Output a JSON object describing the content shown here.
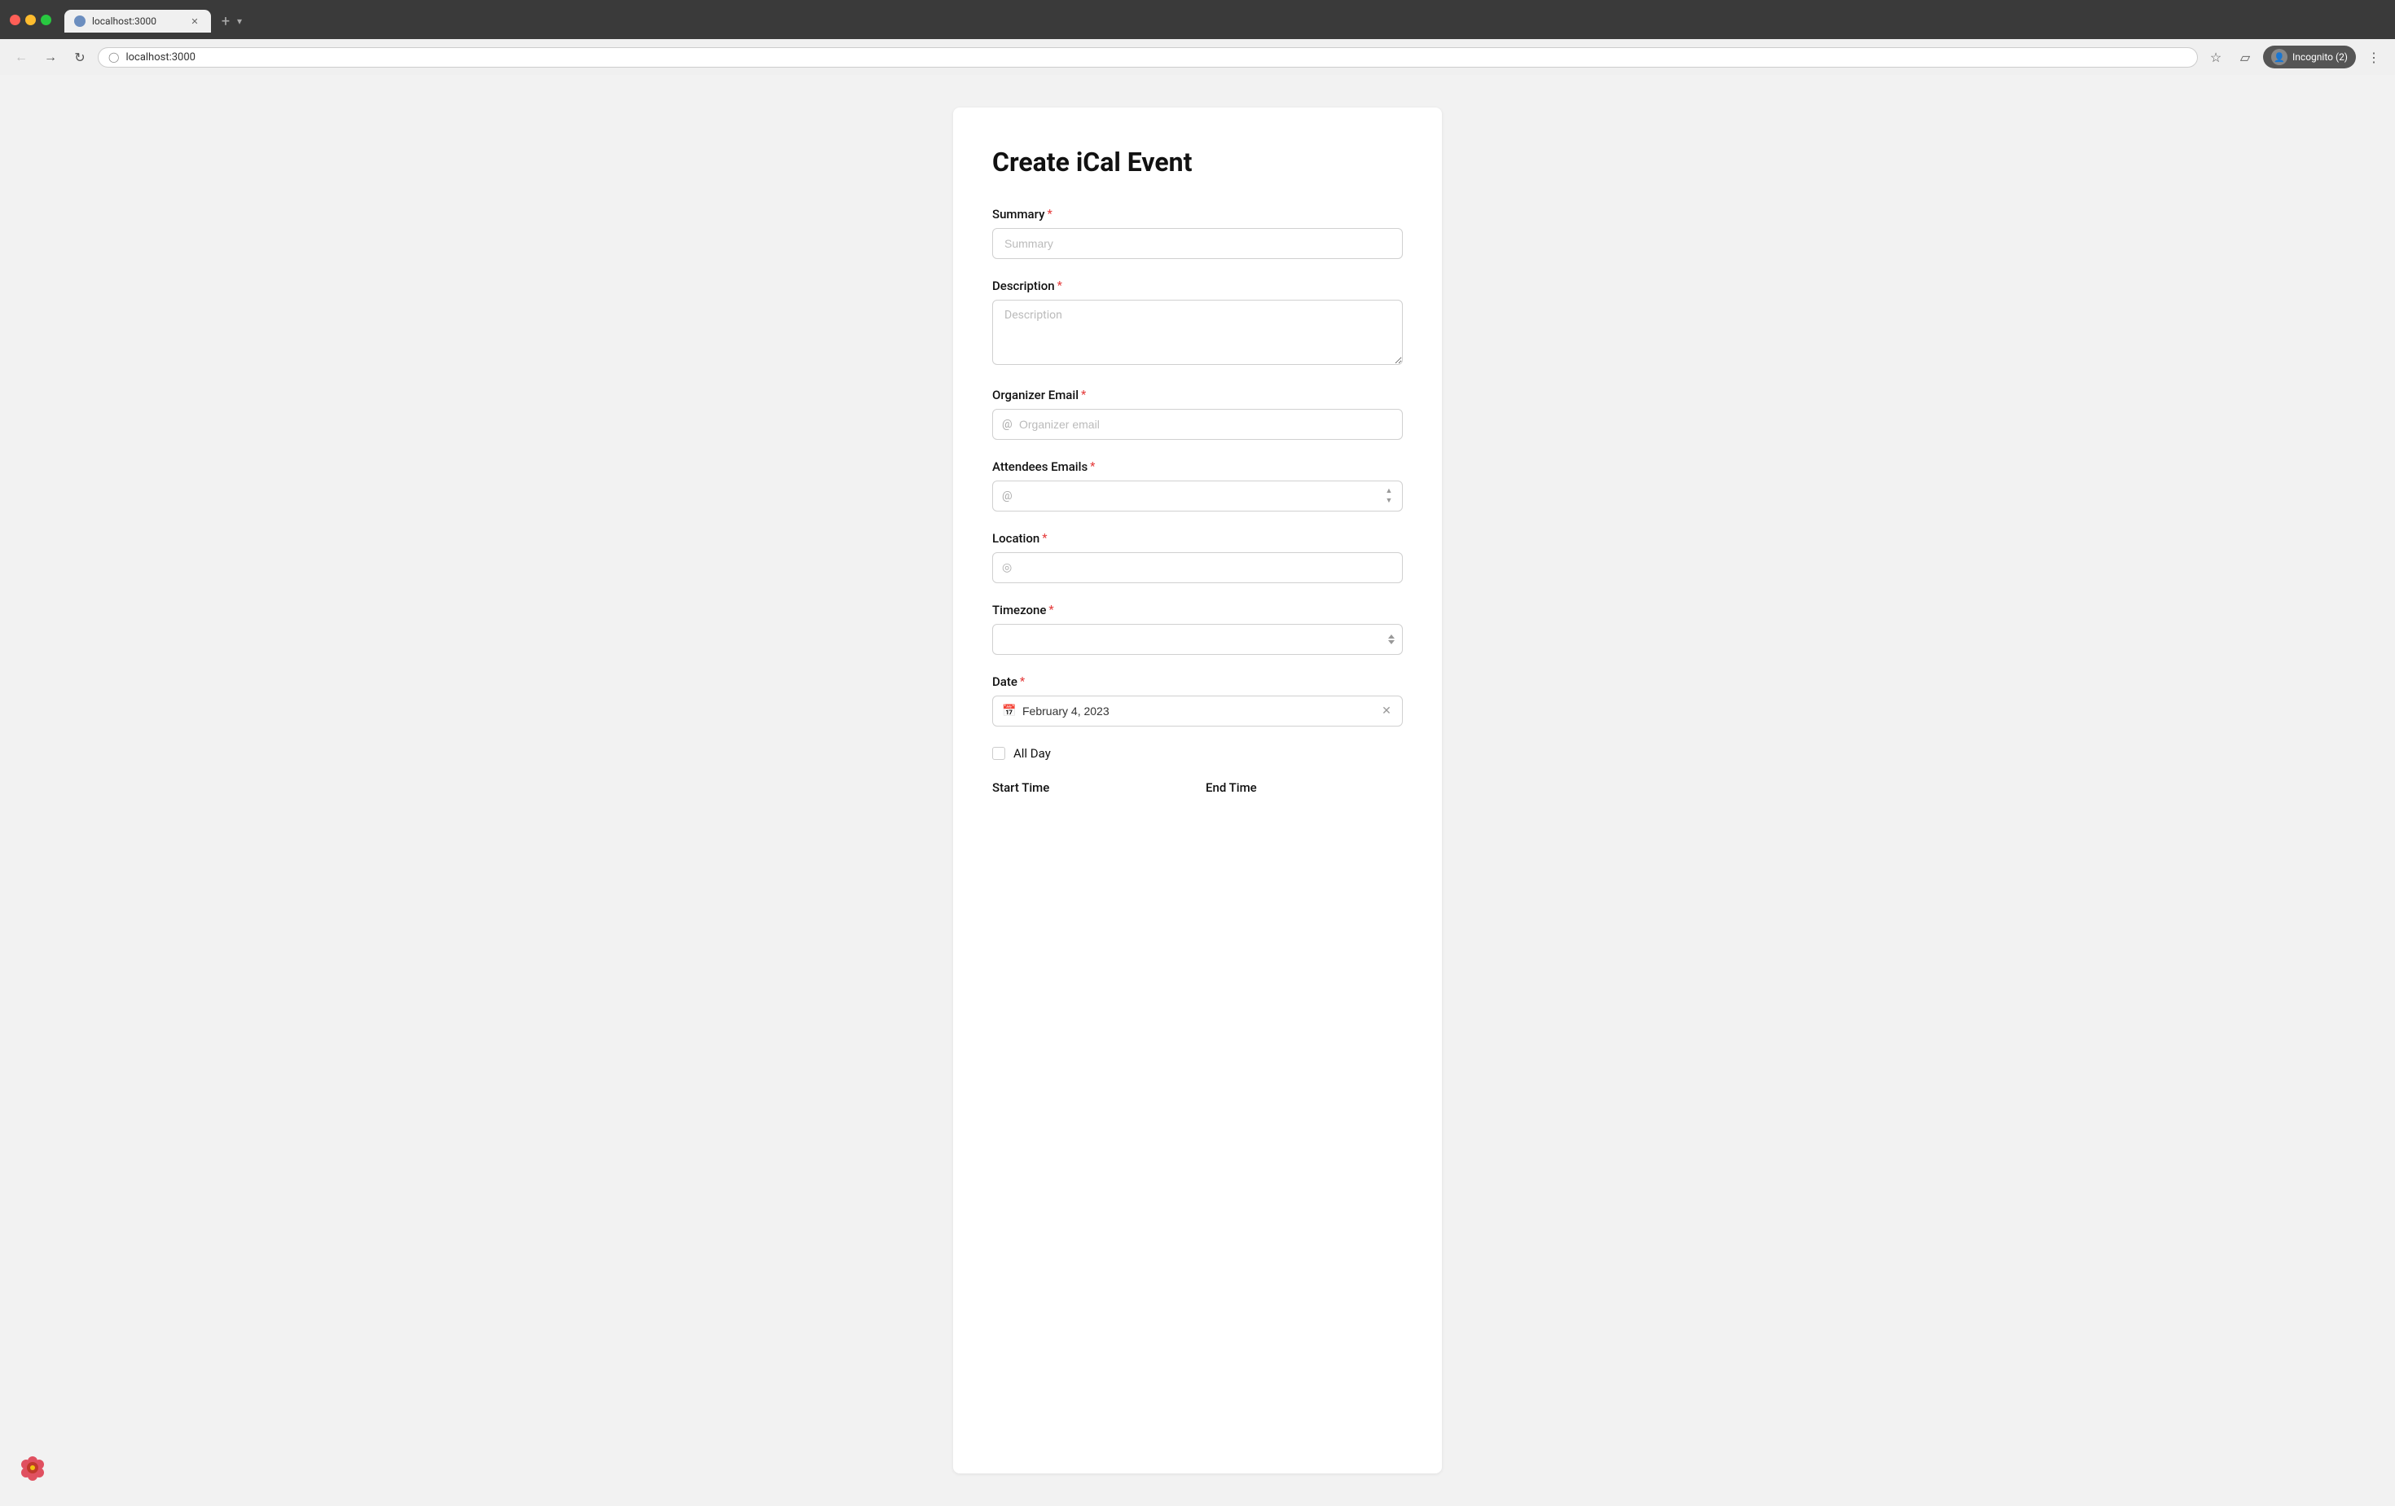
{
  "browser": {
    "url": "localhost:3000",
    "tab_title": "localhost:3000",
    "incognito_label": "Incognito (2)"
  },
  "page": {
    "title": "Create iCal Event"
  },
  "form": {
    "summary_label": "Summary",
    "summary_placeholder": "Summary",
    "description_label": "Description",
    "description_placeholder": "Description",
    "organizer_email_label": "Organizer Email",
    "organizer_email_placeholder": "Organizer email",
    "attendees_emails_label": "Attendees Emails",
    "location_label": "Location",
    "timezone_label": "Timezone",
    "date_label": "Date",
    "date_value": "February 4, 2023",
    "all_day_label": "All Day",
    "start_time_label": "Start Time",
    "end_time_label": "End Time",
    "required_marker": "*"
  }
}
